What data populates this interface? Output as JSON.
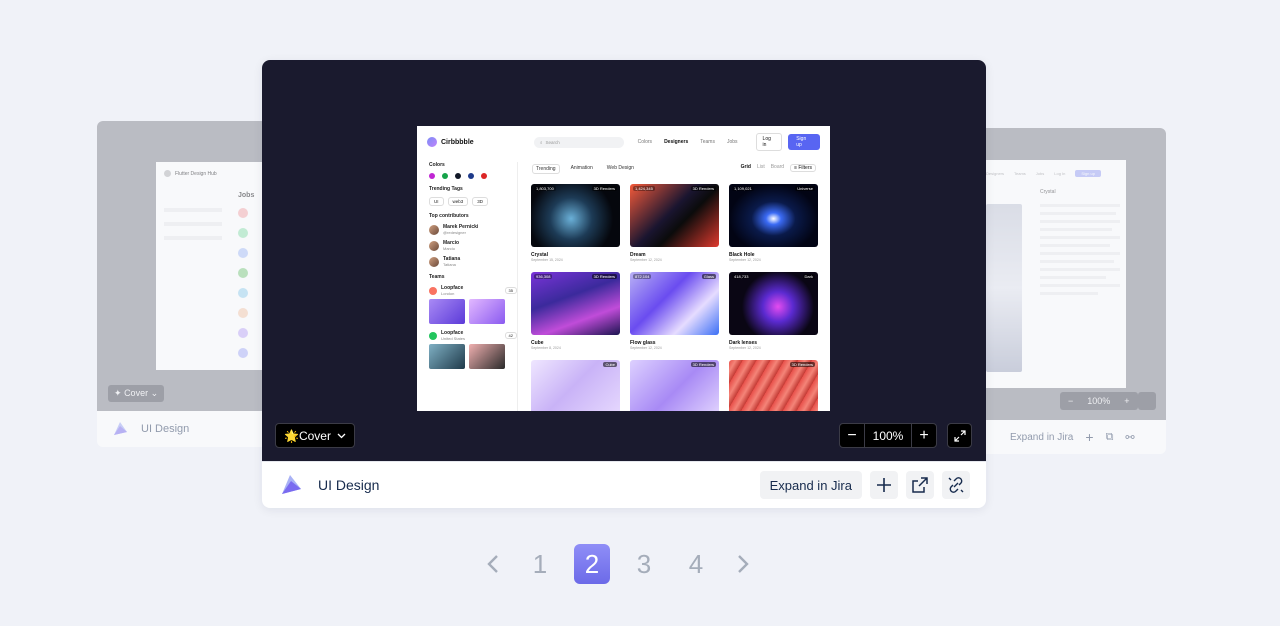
{
  "left_card": {
    "title": "UI Design",
    "preview_title": "Flutter Design Hub",
    "preview_heading": "Jobs",
    "cover_label": "Cover"
  },
  "right_card": {
    "zoom_value": "100%",
    "expand_label": "Expand in Jira",
    "preview_item": "Crystal"
  },
  "main_card": {
    "title": "UI Design",
    "cover_label": "🌟Cover",
    "zoom_value": "100%",
    "expand_label": "Expand in Jira",
    "icons": [
      "add-icon",
      "external-link-icon",
      "unlink-icon"
    ]
  },
  "mock": {
    "brand": "Cirbbbble",
    "search_placeholder": "Search",
    "nav": [
      "Colors",
      "Designers",
      "Teams",
      "Jobs"
    ],
    "login": "Log in",
    "signup": "Sign up",
    "colors_heading": "Colors",
    "color_dots": [
      "#c026d3",
      "#16a34a",
      "#111827",
      "#1e3a8a",
      "#dc2626"
    ],
    "tags_heading": "Trending Tags",
    "tags": [
      "UI",
      "web3",
      "3D"
    ],
    "contributors_heading": "Top contributors",
    "contributors": [
      {
        "name": "Marek Pernicki",
        "handle": "@redesigner"
      },
      {
        "name": "Marcio",
        "handle": "Marcio"
      },
      {
        "name": "Tatiana",
        "handle": "Tatiana"
      }
    ],
    "teams_heading": "Teams",
    "teams": [
      {
        "name": "Loopface",
        "location": "London",
        "count": "35"
      },
      {
        "name": "Loopface",
        "location": "United States",
        "count": "42"
      }
    ],
    "tabs": [
      "Trending",
      "Animation",
      "Web Design"
    ],
    "views": [
      "Grid",
      "List",
      "Board"
    ],
    "filters": "Filters",
    "items": [
      {
        "name": "Crystal",
        "date": "September 15, 2024",
        "num": "1,803,700",
        "tag": "3D Renders",
        "bg": "radial-gradient(circle at 45% 55%, #6ab0d8 0%, #1d3b56 35%, #05070d 70%)"
      },
      {
        "name": "Dream",
        "date": "September 12, 2024",
        "num": "1,424,345",
        "tag": "3D Renders",
        "bg": "linear-gradient(135deg, #f45a3a 0%, #1a1530 45%, #0b0b0b 60%, #e03a2e 100%)"
      },
      {
        "name": "Black Hole",
        "date": "September 12, 2024",
        "num": "1,109,021",
        "tag": "Universe",
        "bg": "radial-gradient(ellipse at 50% 55%, #ffffff 0%, #3b6bf5 12%, #0a1a4a 35%, #020414 70%)"
      },
      {
        "name": "Cube",
        "date": "September 8, 2024",
        "num": "936,308",
        "tag": "3D Renders",
        "bg": "linear-gradient(160deg, #7a34d8 0%, #3b2a9c 40%, #c04cd9 70%, #1c1550 100%)"
      },
      {
        "name": "Flow glass",
        "date": "September 12, 2024",
        "num": "872,104",
        "tag": "Glass",
        "bg": "linear-gradient(135deg, #b8b0f5 0%, #6a4cf0 40%, #e6dcff 70%, #3b6ff5 100%)"
      },
      {
        "name": "Dark lenses",
        "date": "September 12, 2024",
        "num": "418,733",
        "tag": "Dark",
        "bg": "radial-gradient(circle at 55% 55%, #e34cf0 0%, #5b2ad0 25%, #0a0614 60%)"
      },
      {
        "name": "",
        "date": "",
        "num": "",
        "tag": "Cube",
        "bg": "linear-gradient(135deg, #efe6ff 0%, #c9b3f7 45%, #e9dcff 100%)"
      },
      {
        "name": "",
        "date": "",
        "num": "",
        "tag": "3D Renders",
        "bg": "linear-gradient(135deg, #ddd0ff 0%, #a88af5 50%, #e8dcff 100%)"
      },
      {
        "name": "",
        "date": "",
        "num": "",
        "tag": "3D Renders",
        "bg": "repeating-linear-gradient(120deg, #e8504a 0px, #f48478 6px, #c43a34 12px)"
      }
    ]
  },
  "pagination": {
    "prev_icon": "chevron-left-icon",
    "pages": [
      "1",
      "2",
      "3",
      "4"
    ],
    "current": "2",
    "next_icon": "chevron-right-icon"
  },
  "colors": {
    "accent": "#7b79f0",
    "page_bg": "#f0f2f8",
    "preview_bg": "#1a1a2e"
  }
}
